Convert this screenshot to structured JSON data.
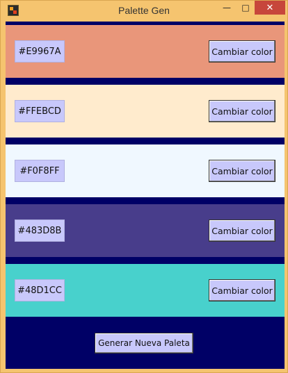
{
  "window": {
    "title": "Palette Gen",
    "icon": "app-icon"
  },
  "palette": [
    {
      "hex": "#E9967A",
      "color": "#E9967A",
      "button_label": "Cambiar color"
    },
    {
      "hex": "#FFEBCD",
      "color": "#FFEBCD",
      "button_label": "Cambiar color"
    },
    {
      "hex": "#F0F8FF",
      "color": "#F0F8FF",
      "button_label": "Cambiar color"
    },
    {
      "hex": "#483D8B",
      "color": "#483D8B",
      "button_label": "Cambiar color"
    },
    {
      "hex": "#48D1CC",
      "color": "#48D1CC",
      "button_label": "Cambiar color"
    }
  ],
  "generate_button_label": "Generar Nueva Paleta",
  "colors": {
    "background": "#000066",
    "button": "#C8C8FB",
    "window_frame": "#F5C46F",
    "close_button": "#C7463B"
  }
}
